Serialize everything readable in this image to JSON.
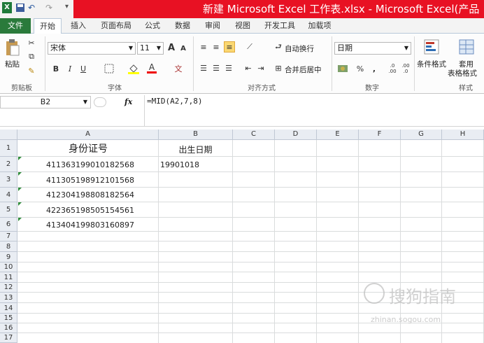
{
  "window": {
    "title": "新建 Microsoft Excel 工作表.xlsx - Microsoft Excel(产品"
  },
  "tabs": [
    "文件",
    "开始",
    "插入",
    "页面布局",
    "公式",
    "数据",
    "审阅",
    "视图",
    "开发工具",
    "加载项"
  ],
  "ribbon": {
    "clipboard": {
      "paste": "粘贴",
      "group": "剪贴板"
    },
    "font": {
      "name": "宋体",
      "size": "11",
      "group": "字体",
      "grow": "A",
      "shrink": "A",
      "bold": "B",
      "italic": "I",
      "underline": "U",
      "phonetic": "文"
    },
    "alignment": {
      "wrap": "自动换行",
      "merge": "合并后居中",
      "group": "对齐方式"
    },
    "number": {
      "format": "日期",
      "percent": "%",
      "comma": ",",
      "inc": ".0 .00",
      "dec": ".00 .0",
      "group": "数字"
    },
    "styles": {
      "conditional": "条件格式",
      "table1": "套用",
      "table2": "表格格式",
      "group": "样式"
    }
  },
  "formula_bar": {
    "cell_ref": "B2",
    "fx": "fx",
    "formula": "=MID(A2,7,8)"
  },
  "grid": {
    "columns": [
      "A",
      "B",
      "C",
      "D",
      "E",
      "F",
      "G",
      "H"
    ],
    "rows": [
      "1",
      "2",
      "3",
      "4",
      "5",
      "6",
      "7",
      "8",
      "9",
      "10",
      "11",
      "12",
      "13",
      "14",
      "15",
      "16",
      "17"
    ],
    "header_a": "身份证号",
    "header_b": "出生日期",
    "ids": [
      "411363199010182568",
      "411305198912101568",
      "412304198808182564",
      "422365198505154561",
      "413404199803160897"
    ],
    "b2": "19901018"
  },
  "watermark": {
    "text": "搜狗指南",
    "url": "zhinan.sogou.com"
  },
  "colors": {
    "title_red": "#e81123",
    "file_tab": "#2a7a3b",
    "header_bg": "#e9edf3"
  }
}
